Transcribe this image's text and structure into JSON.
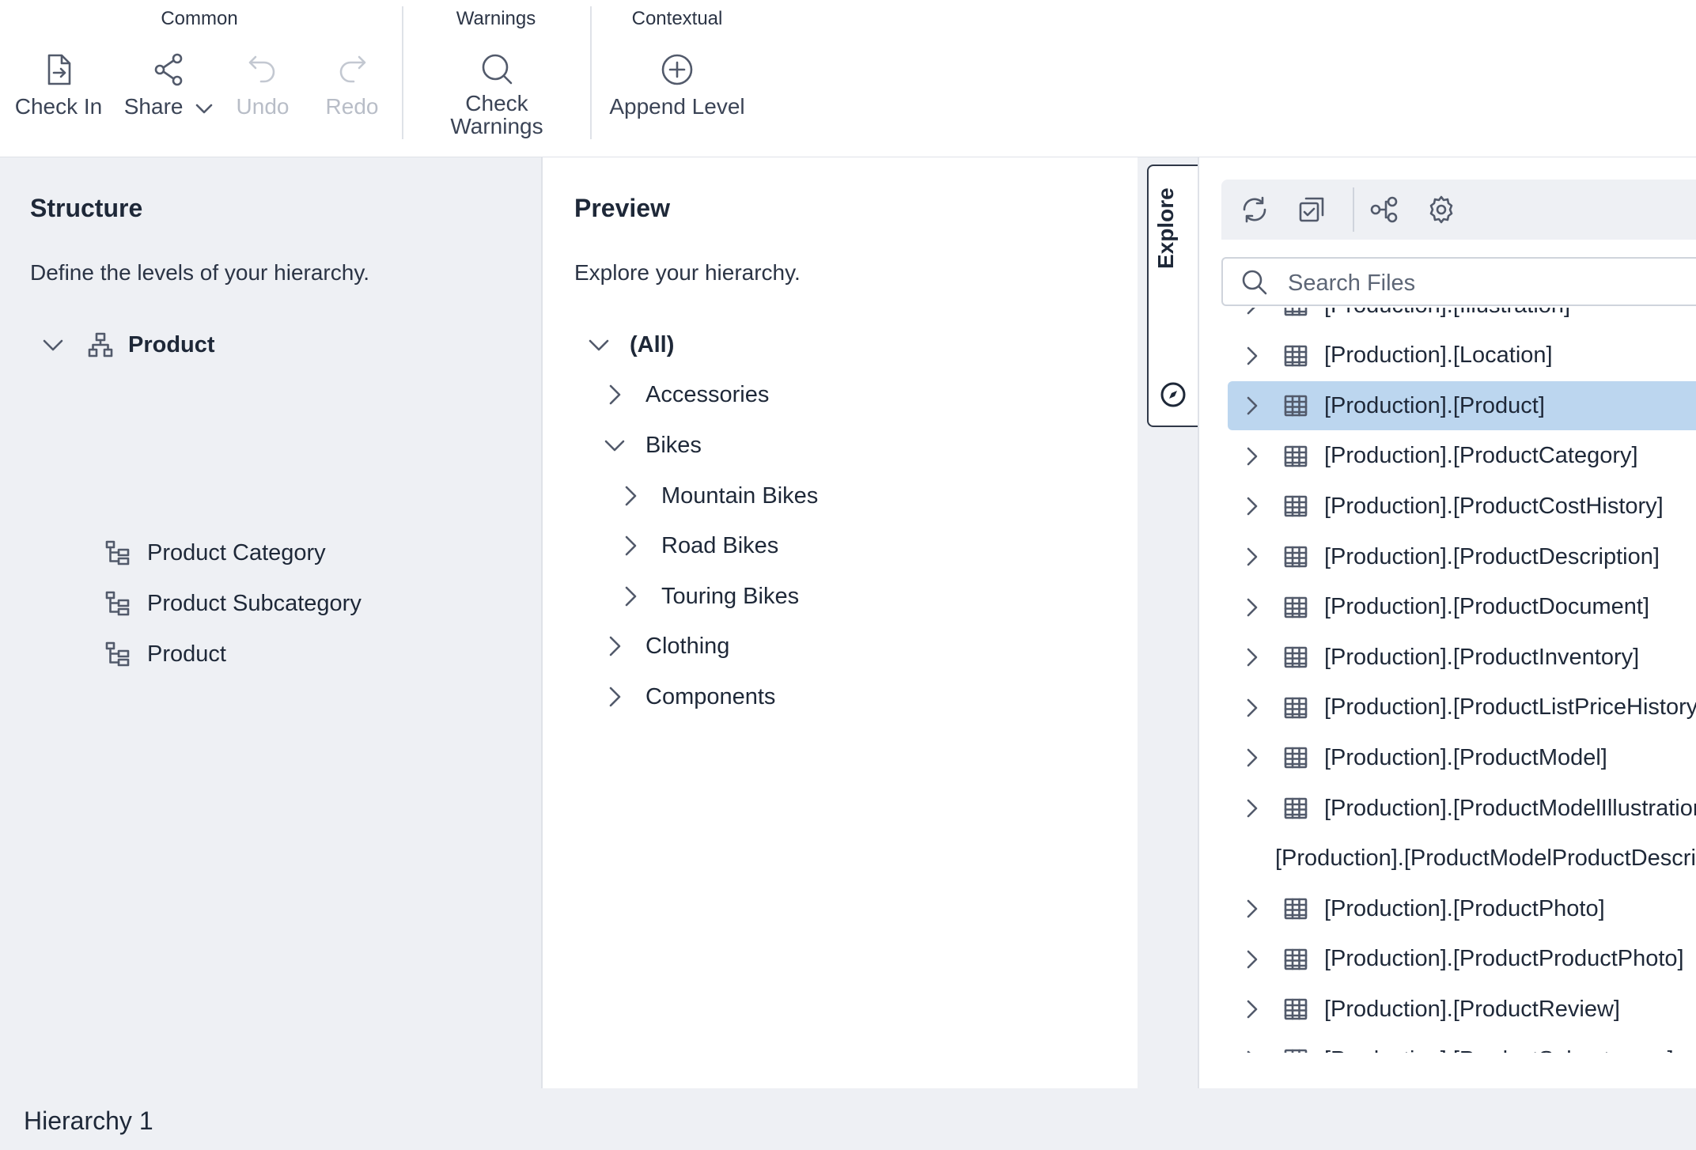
{
  "ribbon": {
    "groups": [
      {
        "title": "Common"
      },
      {
        "title": "Warnings"
      },
      {
        "title": "Contextual"
      }
    ],
    "buttons": {
      "check_in": {
        "label": "Check In",
        "icon": "check-in-icon"
      },
      "share": {
        "label": "Share",
        "icon": "share-icon"
      },
      "undo": {
        "label": "Undo",
        "icon": "undo-icon",
        "disabled": true
      },
      "redo": {
        "label": "Redo",
        "icon": "redo-icon",
        "disabled": true
      },
      "check_warnings": {
        "label_line1": "Check",
        "label_line2": "Warnings",
        "icon": "search-icon"
      },
      "append_level": {
        "label": "Append Level",
        "icon": "plus-circle-icon"
      }
    }
  },
  "structure": {
    "title": "Structure",
    "subtitle": "Define the levels of your hierarchy.",
    "root": {
      "label": "Product",
      "icon": "hierarchy-icon"
    },
    "levels": [
      {
        "label": "Product Category"
      },
      {
        "label": "Product Subcategory"
      },
      {
        "label": "Product"
      }
    ]
  },
  "preview": {
    "title": "Preview",
    "subtitle": "Explore your hierarchy.",
    "tree": [
      {
        "label": "(All)",
        "expanded": true,
        "depth": 0
      },
      {
        "label": "Accessories",
        "expanded": false,
        "depth": 1
      },
      {
        "label": "Bikes",
        "expanded": true,
        "depth": 1
      },
      {
        "label": "Mountain Bikes",
        "expanded": false,
        "depth": 2
      },
      {
        "label": "Road Bikes",
        "expanded": false,
        "depth": 2
      },
      {
        "label": "Touring Bikes",
        "expanded": false,
        "depth": 2
      },
      {
        "label": "Clothing",
        "expanded": false,
        "depth": 1
      },
      {
        "label": "Components",
        "expanded": false,
        "depth": 1
      }
    ]
  },
  "explore": {
    "tab_label": "Explore",
    "search_placeholder": "Search Files",
    "toolbar_icons": [
      "refresh-icon",
      "select-all-icon",
      "relationships-icon",
      "settings-icon"
    ],
    "files": [
      {
        "label": "[Production].[Illustration]"
      },
      {
        "label": "[Production].[Location]"
      },
      {
        "label": "[Production].[Product]",
        "selected": true
      },
      {
        "label": "[Production].[ProductCategory]"
      },
      {
        "label": "[Production].[ProductCostHistory]"
      },
      {
        "label": "[Production].[ProductDescription]"
      },
      {
        "label": "[Production].[ProductDocument]"
      },
      {
        "label": "[Production].[ProductInventory]"
      },
      {
        "label": "[Production].[ProductListPriceHistory]"
      },
      {
        "label": "[Production].[ProductModel]"
      },
      {
        "label": "[Production].[ProductModelIllustration]"
      },
      {
        "label": "[Production].[ProductModelProductDescriptionCulture]"
      },
      {
        "label": "[Production].[ProductPhoto]"
      },
      {
        "label": "[Production].[ProductProductPhoto]"
      },
      {
        "label": "[Production].[ProductReview]"
      },
      {
        "label": "[Production].[ProductSubcategory]"
      }
    ]
  },
  "footer": {
    "tab_label": "Hierarchy 1"
  },
  "colors": {
    "selected_row": "#bcd6ef",
    "panel_bg": "#eef0f4",
    "text": "#1e2838"
  }
}
